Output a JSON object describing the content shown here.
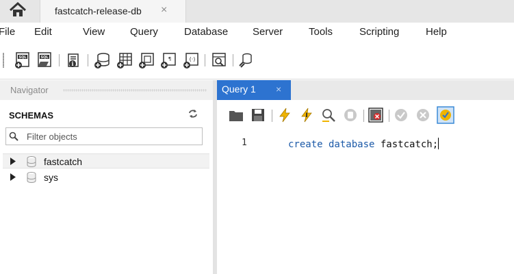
{
  "tabs": {
    "home_icon": "home-icon",
    "connection_tab": {
      "label": "fastcatch-release-db",
      "close": "×"
    }
  },
  "menu": [
    "File",
    "Edit",
    "View",
    "Query",
    "Database",
    "Server",
    "Tools",
    "Scripting",
    "Help"
  ],
  "toolbar": {
    "icons": [
      "new-sql-tab-icon",
      "open-sql-script-icon",
      "inspector-icon",
      "create-schema-icon",
      "create-table-icon",
      "create-view-icon",
      "create-procedure-icon",
      "create-function-icon",
      "search-table-data-icon",
      "reconnect-icon"
    ]
  },
  "navigator": {
    "title": "Navigator",
    "schemas_label": "SCHEMAS",
    "filter_placeholder": "Filter objects",
    "schemas": [
      {
        "name": "fastcatch",
        "selected": true
      },
      {
        "name": "sys",
        "selected": false
      }
    ]
  },
  "editor": {
    "tab_label": "Query 1",
    "tab_close": "×",
    "toolbar_icons": [
      "open-file-icon",
      "save-icon",
      "execute-icon",
      "execute-current-icon",
      "explain-icon",
      "stop-icon",
      "toggle-error-stop-icon",
      "commit-icon",
      "rollback-icon",
      "autocommit-icon"
    ],
    "lines": [
      {
        "number": "1",
        "keyword": "create database",
        "identifier": "fastcatch",
        "terminator": ";"
      }
    ]
  },
  "colors": {
    "accent": "#2d73d0",
    "keyword": "#1c5aa8",
    "lightning": "#f0b400"
  }
}
